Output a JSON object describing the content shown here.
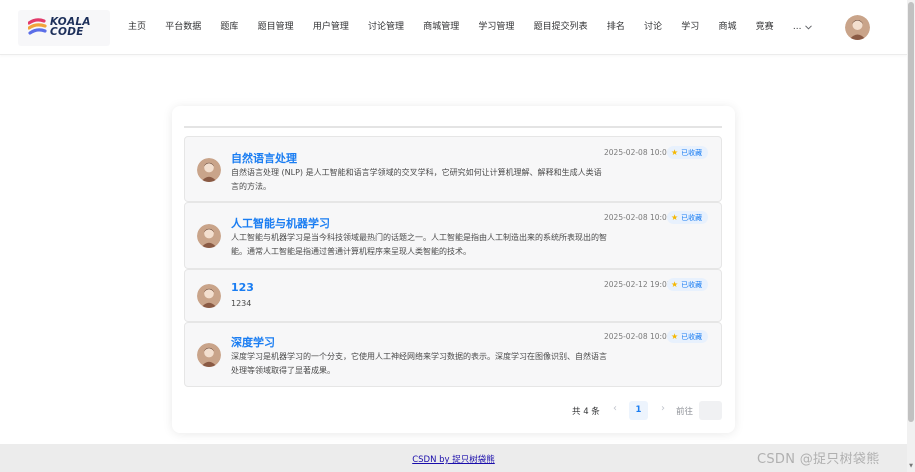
{
  "header": {
    "logo_text_line1": "KOALA",
    "logo_text_line2": "CODE",
    "nav": [
      "主页",
      "平台数据",
      "题库",
      "题目管理",
      "用户管理",
      "讨论管理",
      "商城管理",
      "学习管理",
      "题目提交列表",
      "排名",
      "讨论",
      "学习",
      "商城",
      "竞赛"
    ],
    "more_label": "..."
  },
  "favorites": [
    {
      "title": "自然语言处理",
      "desc": "自然语言处理 (NLP) 是人工智能和语言学领域的交叉学科，它研究如何让计算机理解、解释和生成人类语言的方法。",
      "date": "2025-02-08 10:00",
      "badge": "已收藏"
    },
    {
      "title": "人工智能与机器学习",
      "desc": "人工智能与机器学习是当今科技领域最热门的话题之一。人工智能是指由人工制造出来的系统所表现出的智能。通常人工智能是指通过普通计算机程序来呈现人类智能的技术。",
      "date": "2025-02-08 10:00",
      "badge": "已收藏"
    },
    {
      "title": "123",
      "desc": "1234",
      "date": "2025-02-12 19:05",
      "badge": "已收藏"
    },
    {
      "title": "深度学习",
      "desc": "深度学习是机器学习的一个分支，它使用人工神经网络来学习数据的表示。深度学习在图像识别、自然语言处理等领域取得了显著成果。",
      "date": "2025-02-08 10:00",
      "badge": "已收藏"
    }
  ],
  "pagination": {
    "total_text": "共 4 条",
    "current_page": "1",
    "goto_label": "前往"
  },
  "footer": {
    "link_text": "CSDN by 捉只树袋熊"
  },
  "watermark": "CSDN @捉只树袋熊",
  "colors": {
    "accent": "#1a7df2",
    "star": "#f5b700"
  }
}
